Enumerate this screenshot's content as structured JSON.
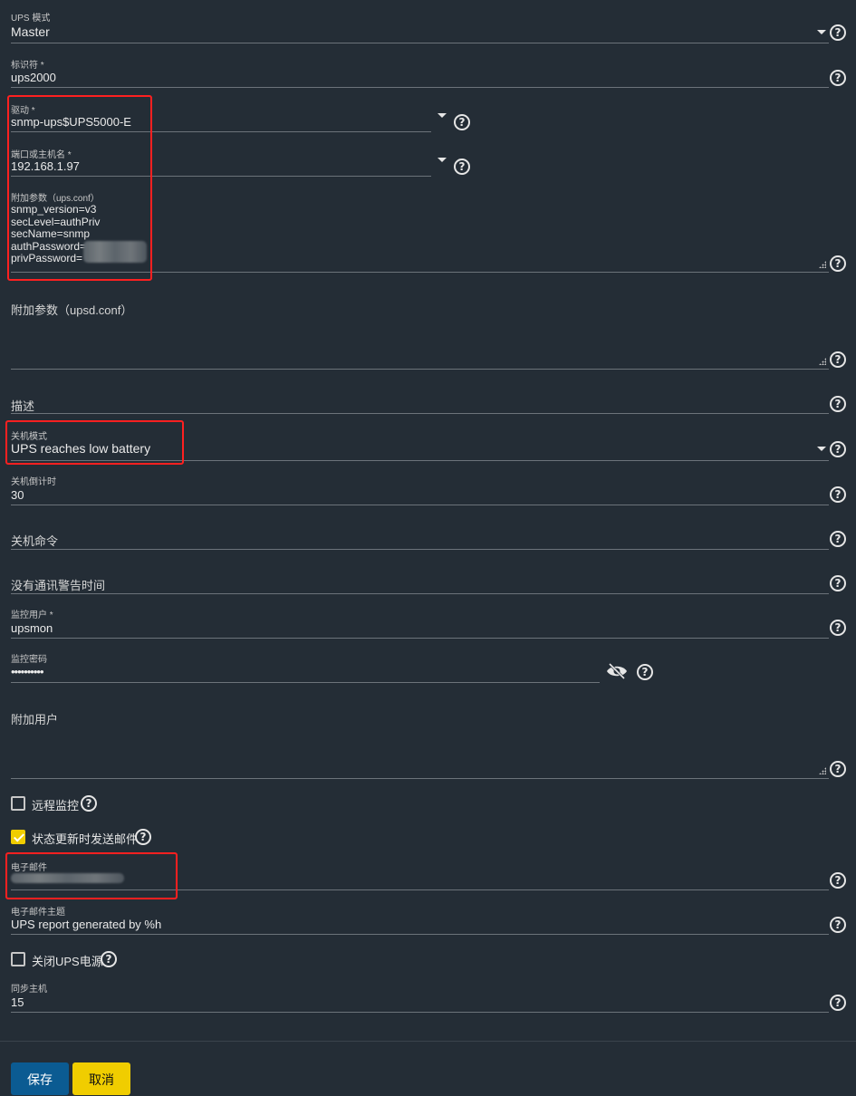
{
  "form": {
    "ups_mode": {
      "label": "UPS 模式",
      "value": "Master"
    },
    "identifier": {
      "label": "标识符 *",
      "value": "ups2000"
    },
    "driver": {
      "label": "驱动 *",
      "value": "snmp-ups$UPS5000-E"
    },
    "port": {
      "label": "端口或主机名 *",
      "value": "192.168.1.97"
    },
    "aux_params_ups": {
      "label": "附加参数（ups.conf）",
      "lines": [
        "snmp_version=v3",
        "secLevel=authPriv",
        "secName=snmp",
        "authPassword=",
        "privPassword="
      ]
    },
    "aux_params_upsd": {
      "placeholder": "附加参数（upsd.conf）",
      "value": ""
    },
    "description": {
      "placeholder": "描述",
      "value": ""
    },
    "shutdown_mode": {
      "label": "关机模式",
      "value": "UPS reaches low battery"
    },
    "shutdown_timer": {
      "label": "关机倒计时",
      "value": "30"
    },
    "shutdown_command": {
      "placeholder": "关机命令",
      "value": ""
    },
    "nocomm_warn_time": {
      "placeholder": "没有通讯警告时间",
      "value": ""
    },
    "monitor_user": {
      "label": "监控用户 *",
      "value": "upsmon"
    },
    "monitor_password": {
      "label": "监控密码",
      "value": "••••••••••"
    },
    "extra_users": {
      "placeholder": "附加用户",
      "value": ""
    },
    "remote_monitor": {
      "label": "远程监控",
      "checked": false
    },
    "email_on_status": {
      "label": "状态更新时发送邮件",
      "checked": true
    },
    "email": {
      "label": "电子邮件",
      "value": ""
    },
    "email_subject": {
      "label": "电子邮件主题",
      "value": "UPS report generated by %h"
    },
    "power_off_ups": {
      "label": "关闭UPS电源",
      "checked": false
    },
    "host_sync": {
      "label": "同步主机",
      "value": "15"
    }
  },
  "actions": {
    "save": "保存",
    "cancel": "取消"
  },
  "colors": {
    "background": "#242d36",
    "primary": "#0b5b92",
    "accent": "#f0cd00",
    "annotation": "#ff2020"
  }
}
